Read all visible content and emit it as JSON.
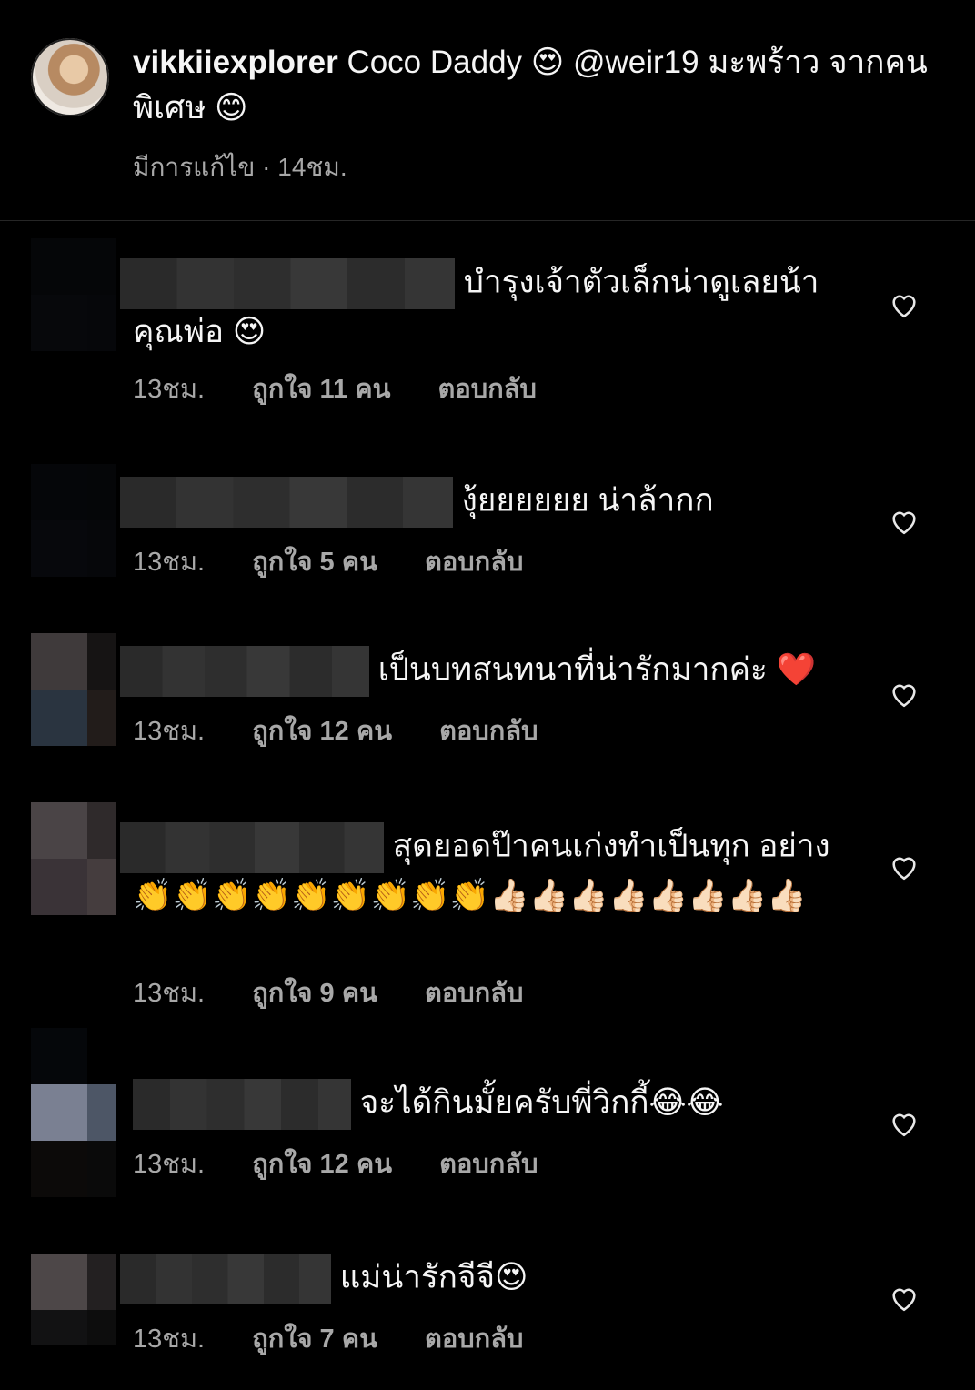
{
  "caption": {
    "username": "vikkiiexplorer",
    "text": "Coco Daddy 😍 @weir19 มะพร้าว จากคนพิเศษ 😊",
    "meta": "มีการแก้ไข · 14ชม."
  },
  "comments": [
    {
      "text": "บำรุงเจ้าตัวเล็กน่าดูเลยน้า คุณพ่อ 😍",
      "time": "13ชม.",
      "likes": "ถูกใจ 11 คน",
      "reply": "ตอบกลับ"
    },
    {
      "text": "งุ้ยยยยยย น่าล้ากก",
      "time": "13ชม.",
      "likes": "ถูกใจ 5 คน",
      "reply": "ตอบกลับ"
    },
    {
      "text": "เป็นบทสนทนาที่น่ารักมากค่ะ ❤️",
      "time": "13ชม.",
      "likes": "ถูกใจ 12 คน",
      "reply": "ตอบกลับ"
    },
    {
      "text": "สุดยอดป๊าคนเก่งทำเป็นทุก อย่าง👏👏👏👏👏👏👏👏👏👍🏻👍🏻👍🏻👍🏻👍🏻👍🏻👍🏻👍🏻",
      "time": "13ชม.",
      "likes": "ถูกใจ 9 คน",
      "reply": "ตอบกลับ"
    },
    {
      "text": "จะได้กินมั้ยครับพี่วิกกี้😂😂",
      "time": "13ชม.",
      "likes": "ถูกใจ 12 คน",
      "reply": "ตอบกลับ"
    },
    {
      "text": "แม่น่ารักจีจี😍",
      "time": "13ชม.",
      "likes": "ถูกใจ 7 คน",
      "reply": "ตอบกลับ"
    }
  ],
  "icons": {
    "like": "heart-outline-icon"
  },
  "colors": {
    "background": "#000000",
    "text": "#f5f5f5",
    "secondary": "#a8a8a8"
  }
}
